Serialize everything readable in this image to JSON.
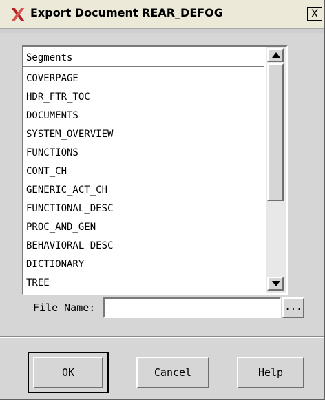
{
  "window": {
    "title": "Export Document REAR_DEFOG",
    "title_icon": "x-logo-icon",
    "close_label": "X",
    "accent_color": "#c0392b"
  },
  "segments": {
    "header": "Segments",
    "items": [
      "COVERPAGE",
      "HDR_FTR_TOC",
      "DOCUMENTS",
      "SYSTEM_OVERVIEW",
      "FUNCTIONS",
      "CONT_CH",
      "GENERIC_ACT_CH",
      "FUNCTIONAL_DESC",
      "PROC_AND_GEN",
      "BEHAVIORAL_DESC",
      "DICTIONARY",
      "TREE"
    ]
  },
  "file": {
    "label": "File Name:",
    "value": "",
    "browse_label": "..."
  },
  "buttons": {
    "ok": "OK",
    "cancel": "Cancel",
    "help": "Help"
  }
}
